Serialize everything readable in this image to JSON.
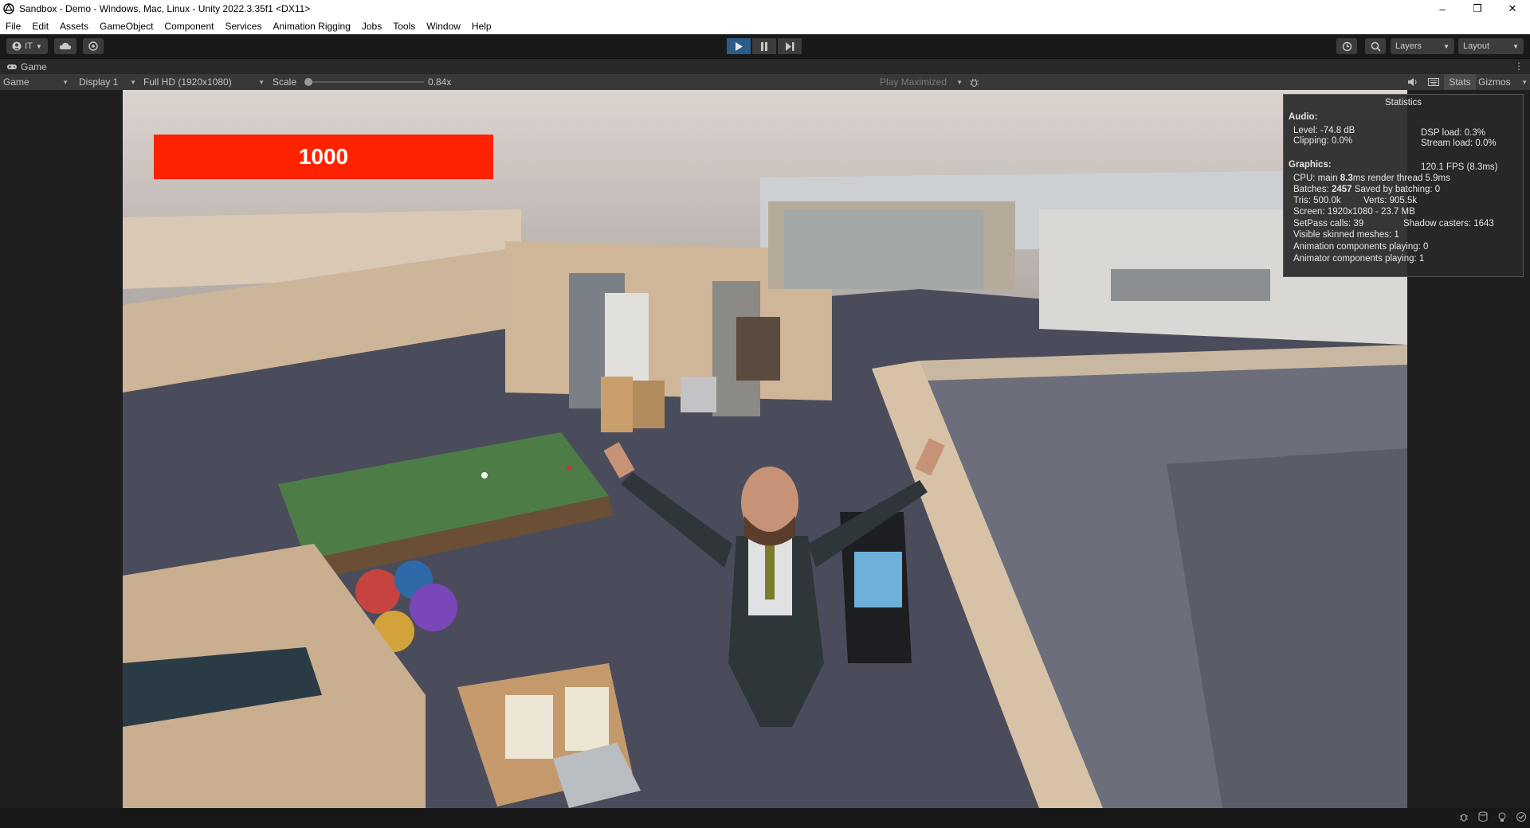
{
  "window": {
    "title": "Sandbox - Demo - Windows, Mac, Linux - Unity 2022.3.35f1 <DX11>",
    "minimize": "–",
    "maximize": "❐",
    "close": "✕"
  },
  "menu": [
    "File",
    "Edit",
    "Assets",
    "GameObject",
    "Component",
    "Services",
    "Animation Rigging",
    "Jobs",
    "Tools",
    "Window",
    "Help"
  ],
  "toolbar": {
    "account_label": "IT",
    "layers_label": "Layers",
    "layout_label": "Layout"
  },
  "game_tab": {
    "label": "Game"
  },
  "game_toolbar": {
    "view_mode": "Game",
    "display": "Display 1",
    "resolution": "Full HD (1920x1080)",
    "scale_label": "Scale",
    "scale_value": "0.84x",
    "play_mode": "Play Maximized",
    "stats_label": "Stats",
    "gizmos_label": "Gizmos"
  },
  "hud": {
    "score": "1000",
    "score_color": "#ff2200"
  },
  "stats": {
    "title": "Statistics",
    "audio_heading": "Audio:",
    "level": "Level: -74.8 dB",
    "clipping": "Clipping: 0.0%",
    "dsp_load": "DSP load: 0.3%",
    "stream_load": "Stream load: 0.0%",
    "graphics_heading": "Graphics:",
    "fps": "120.1 FPS (8.3ms)",
    "cpu_prefix": "CPU: main ",
    "cpu_main": "8.3",
    "cpu_suffix": "ms  render thread 5.9ms",
    "batches_prefix": "Batches: ",
    "batches": "2457",
    "batches_suffix": "  Saved by batching: 0",
    "tris": "Tris: 500.0k",
    "verts": "Verts: 905.5k",
    "screen": "Screen: 1920x1080 - 23.7 MB",
    "setpass": "SetPass calls: 39",
    "shadow_casters": "Shadow casters: 1643",
    "skinned": "Visible skinned meshes: 1",
    "anim_components": "Animation components playing: 0",
    "animator_components": "Animator components playing: 1"
  }
}
